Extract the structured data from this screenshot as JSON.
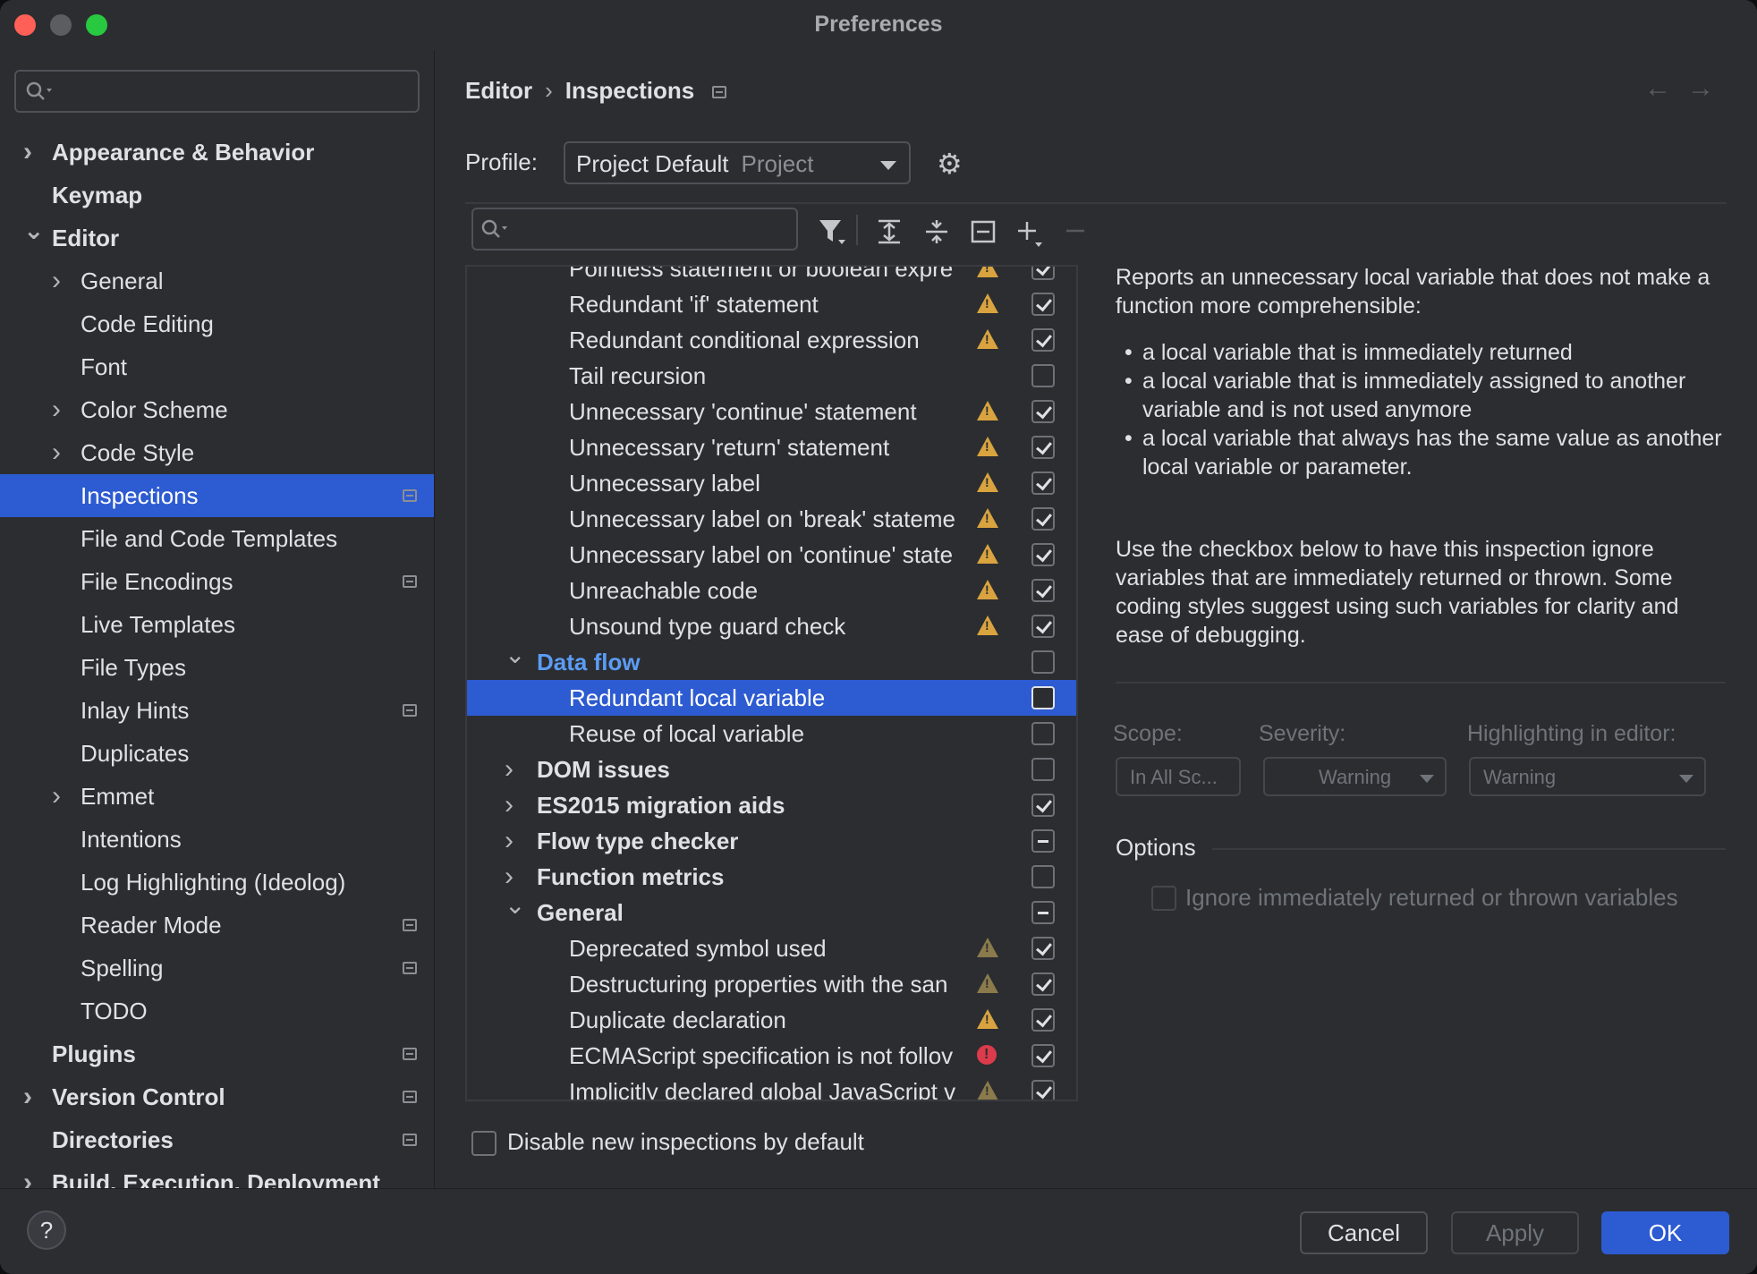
{
  "window": {
    "title": "Preferences"
  },
  "sidebar": {
    "search_placeholder": "",
    "items": [
      {
        "label": "Appearance & Behavior",
        "level": 0,
        "chevron": "right",
        "bold": true,
        "badge": false
      },
      {
        "label": "Keymap",
        "level": 0,
        "chevron": "",
        "bold": true,
        "badge": false
      },
      {
        "label": "Editor",
        "level": 0,
        "chevron": "down",
        "bold": true,
        "badge": false
      },
      {
        "label": "General",
        "level": 1,
        "chevron": "right",
        "bold": false,
        "badge": false
      },
      {
        "label": "Code Editing",
        "level": 1,
        "chevron": "",
        "bold": false,
        "badge": false
      },
      {
        "label": "Font",
        "level": 1,
        "chevron": "",
        "bold": false,
        "badge": false
      },
      {
        "label": "Color Scheme",
        "level": 1,
        "chevron": "right",
        "bold": false,
        "badge": false
      },
      {
        "label": "Code Style",
        "level": 1,
        "chevron": "right",
        "bold": false,
        "badge": false
      },
      {
        "label": "Inspections",
        "level": 1,
        "chevron": "",
        "bold": false,
        "badge": true,
        "selected": true
      },
      {
        "label": "File and Code Templates",
        "level": 1,
        "chevron": "",
        "bold": false,
        "badge": false
      },
      {
        "label": "File Encodings",
        "level": 1,
        "chevron": "",
        "bold": false,
        "badge": true
      },
      {
        "label": "Live Templates",
        "level": 1,
        "chevron": "",
        "bold": false,
        "badge": false
      },
      {
        "label": "File Types",
        "level": 1,
        "chevron": "",
        "bold": false,
        "badge": false
      },
      {
        "label": "Inlay Hints",
        "level": 1,
        "chevron": "",
        "bold": false,
        "badge": true
      },
      {
        "label": "Duplicates",
        "level": 1,
        "chevron": "",
        "bold": false,
        "badge": false
      },
      {
        "label": "Emmet",
        "level": 1,
        "chevron": "right",
        "bold": false,
        "badge": false
      },
      {
        "label": "Intentions",
        "level": 1,
        "chevron": "",
        "bold": false,
        "badge": false
      },
      {
        "label": "Log Highlighting (Ideolog)",
        "level": 1,
        "chevron": "",
        "bold": false,
        "badge": false
      },
      {
        "label": "Reader Mode",
        "level": 1,
        "chevron": "",
        "bold": false,
        "badge": true
      },
      {
        "label": "Spelling",
        "level": 1,
        "chevron": "",
        "bold": false,
        "badge": true
      },
      {
        "label": "TODO",
        "level": 1,
        "chevron": "",
        "bold": false,
        "badge": false
      },
      {
        "label": "Plugins",
        "level": 0,
        "chevron": "",
        "bold": true,
        "badge": true
      },
      {
        "label": "Version Control",
        "level": 0,
        "chevron": "right",
        "bold": true,
        "badge": true
      },
      {
        "label": "Directories",
        "level": 0,
        "chevron": "",
        "bold": true,
        "badge": true
      },
      {
        "label": "Build, Execution, Deployment",
        "level": 0,
        "chevron": "right",
        "bold": true,
        "badge": false
      }
    ]
  },
  "header": {
    "breadcrumb": [
      "Editor",
      "Inspections"
    ],
    "back_icon": "arrow-left-icon",
    "forward_icon": "arrow-right-icon"
  },
  "profile": {
    "label": "Profile:",
    "value": "Project Default",
    "scope": "Project"
  },
  "toolbar": {
    "search_placeholder": "",
    "icons": [
      "filter-icon",
      "expand-all-icon",
      "collapse-all-icon",
      "reset-icon",
      "add-icon",
      "remove-icon"
    ]
  },
  "inspections": [
    {
      "name": "Pointless statement or boolean expre",
      "type": "leaf",
      "severity": "warning",
      "state": "checked"
    },
    {
      "name": "Redundant 'if' statement",
      "type": "leaf",
      "severity": "warning",
      "state": "checked"
    },
    {
      "name": "Redundant conditional expression",
      "type": "leaf",
      "severity": "warning",
      "state": "checked"
    },
    {
      "name": "Tail recursion",
      "type": "leaf",
      "severity": "",
      "state": "unchecked"
    },
    {
      "name": "Unnecessary 'continue' statement",
      "type": "leaf",
      "severity": "warning",
      "state": "checked"
    },
    {
      "name": "Unnecessary 'return' statement",
      "type": "leaf",
      "severity": "warning",
      "state": "checked"
    },
    {
      "name": "Unnecessary label",
      "type": "leaf",
      "severity": "warning",
      "state": "checked"
    },
    {
      "name": "Unnecessary label on 'break' stateme",
      "type": "leaf",
      "severity": "warning",
      "state": "checked"
    },
    {
      "name": "Unnecessary label on 'continue' state",
      "type": "leaf",
      "severity": "warning",
      "state": "checked"
    },
    {
      "name": "Unreachable code",
      "type": "leaf",
      "severity": "warning",
      "state": "checked"
    },
    {
      "name": "Unsound type guard check",
      "type": "leaf",
      "severity": "warning",
      "state": "checked"
    },
    {
      "name": "Data flow",
      "type": "group",
      "chevron": "down",
      "active": true,
      "state": "unchecked"
    },
    {
      "name": "Redundant local variable",
      "type": "leaf",
      "severity": "",
      "state": "unchecked",
      "selected": true
    },
    {
      "name": "Reuse of local variable",
      "type": "leaf",
      "severity": "",
      "state": "unchecked"
    },
    {
      "name": "DOM issues",
      "type": "group",
      "chevron": "right",
      "state": "unchecked"
    },
    {
      "name": "ES2015 migration aids",
      "type": "group",
      "chevron": "right",
      "state": "checked"
    },
    {
      "name": "Flow type checker",
      "type": "group",
      "chevron": "right",
      "state": "mixed"
    },
    {
      "name": "Function metrics",
      "type": "group",
      "chevron": "right",
      "state": "unchecked"
    },
    {
      "name": "General",
      "type": "group",
      "chevron": "down",
      "state": "mixed"
    },
    {
      "name": "Deprecated symbol used",
      "type": "leaf",
      "severity": "warning-weak",
      "state": "checked"
    },
    {
      "name": "Destructuring properties with the san",
      "type": "leaf",
      "severity": "warning-weak",
      "state": "checked"
    },
    {
      "name": "Duplicate declaration",
      "type": "leaf",
      "severity": "warning",
      "state": "checked"
    },
    {
      "name": "ECMAScript specification is not follov",
      "type": "leaf",
      "severity": "error",
      "state": "checked"
    },
    {
      "name": "Implicitly declared global JavaScript v",
      "type": "leaf",
      "severity": "warning-weak",
      "state": "checked"
    }
  ],
  "disable_new": {
    "label": "Disable new inspections by default"
  },
  "description": {
    "intro": "Reports an unnecessary local variable that does not make a function more comprehensible:",
    "bullets": [
      "a local variable that is immediately returned",
      "a local variable that is immediately assigned to another variable and is not used anymore",
      "a local variable that always has the same value as another local variable or parameter."
    ],
    "note": "Use the checkbox below to have this inspection ignore variables that are immediately returned or thrown. Some coding styles suggest using such variables for clarity and ease of debugging."
  },
  "settings": {
    "scope_label": "Scope:",
    "scope_value": "In All Sc...",
    "severity_label": "Severity:",
    "severity_value": "Warning",
    "highlighting_label": "Highlighting in editor:",
    "highlighting_value": "Warning"
  },
  "options": {
    "title": "Options",
    "ignore_label": "Ignore immediately returned or thrown variables"
  },
  "footer": {
    "help": "?",
    "cancel": "Cancel",
    "apply": "Apply",
    "ok": "OK"
  },
  "colors": {
    "accent": "#2d5bd1",
    "warning": "#d9a33f",
    "error": "#db3b4b",
    "link": "#5b9cf5"
  }
}
